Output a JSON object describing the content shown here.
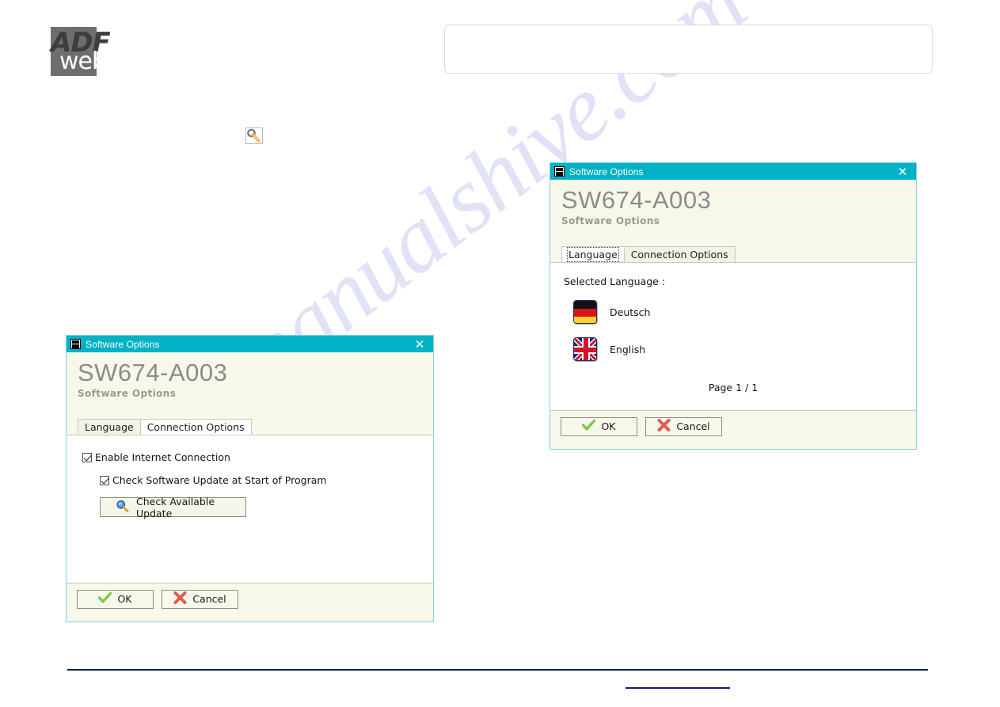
{
  "page": {
    "logo": {
      "top_text": "ADF",
      "bottom_text": "web"
    },
    "watermark_text": "manualshive.com",
    "tool_icon_name": "wrench-icon"
  },
  "colors": {
    "titlebar_teal": "#00b2c6",
    "dialog_ivory": "#f7f7ea",
    "panel_white": "#ffffff",
    "big_title_gray": "#8c8c8c",
    "ok_green": "#7ac943",
    "cancel_red": "#e05b52",
    "watermark_blue": "#c9cbf0",
    "rule_navy": "#0b2340",
    "link_navy": "#191970"
  },
  "dialog_left": {
    "titlebar": {
      "title": "Software Options",
      "close_label": "✕"
    },
    "header": {
      "big_title": "SW674-A003",
      "subtitle": "Software Options"
    },
    "tabs": [
      {
        "label": "Language",
        "active": false
      },
      {
        "label": "Connection Options",
        "active": true
      }
    ],
    "connection_panel": {
      "enable_internet": {
        "label": "Enable Internet Connection",
        "checked": true
      },
      "check_update_start": {
        "label": "Check Software Update at Start of Program",
        "checked": true
      },
      "check_update_button": {
        "label": "Check Available Update",
        "icon": "magnifier-icon"
      }
    },
    "footer": {
      "ok_label": "OK",
      "cancel_label": "Cancel"
    }
  },
  "dialog_right": {
    "titlebar": {
      "title": "Software Options",
      "close_label": "✕"
    },
    "header": {
      "big_title": "SW674-A003",
      "subtitle": "Software Options"
    },
    "tabs": [
      {
        "label": "Language",
        "active": true
      },
      {
        "label": "Connection Options",
        "active": false
      }
    ],
    "language_panel": {
      "selected_language_label": "Selected Language :",
      "languages": [
        {
          "name": "Deutsch",
          "flag": "flag-germany"
        },
        {
          "name": "English",
          "flag": "flag-united-kingdom"
        }
      ],
      "page_indicator": "Page 1 / 1"
    },
    "footer": {
      "ok_label": "OK",
      "cancel_label": "Cancel"
    }
  }
}
